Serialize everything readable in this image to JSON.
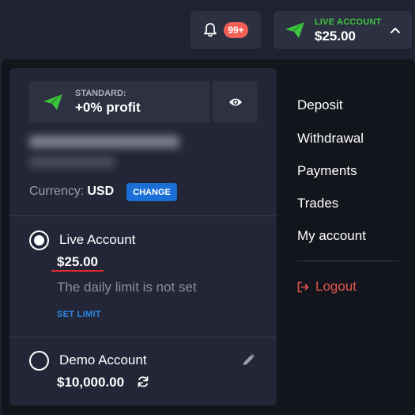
{
  "header": {
    "notification_badge": "99+",
    "account_type_label": "LIVE ACCOUNT",
    "account_balance": "$25.00"
  },
  "profile": {
    "plan_label": "STANDARD:",
    "plan_value": "+0% profit",
    "currency_label": "Currency:",
    "currency_value": "USD",
    "change_label": "CHANGE"
  },
  "accounts": {
    "live": {
      "title": "Live Account",
      "balance": "$25.00",
      "limit_text": "The daily limit is not set",
      "set_limit_label": "SET LIMIT",
      "selected": true
    },
    "demo": {
      "title": "Demo Account",
      "balance": "$10,000.00",
      "selected": false
    }
  },
  "menu": {
    "items": [
      "Deposit",
      "Withdrawal",
      "Payments",
      "Trades",
      "My account"
    ],
    "logout_label": "Logout"
  },
  "colors": {
    "accent_green": "#3ec43e",
    "accent_blue": "#1a6fd6",
    "danger": "#e2554a",
    "badge": "#f25f55"
  }
}
